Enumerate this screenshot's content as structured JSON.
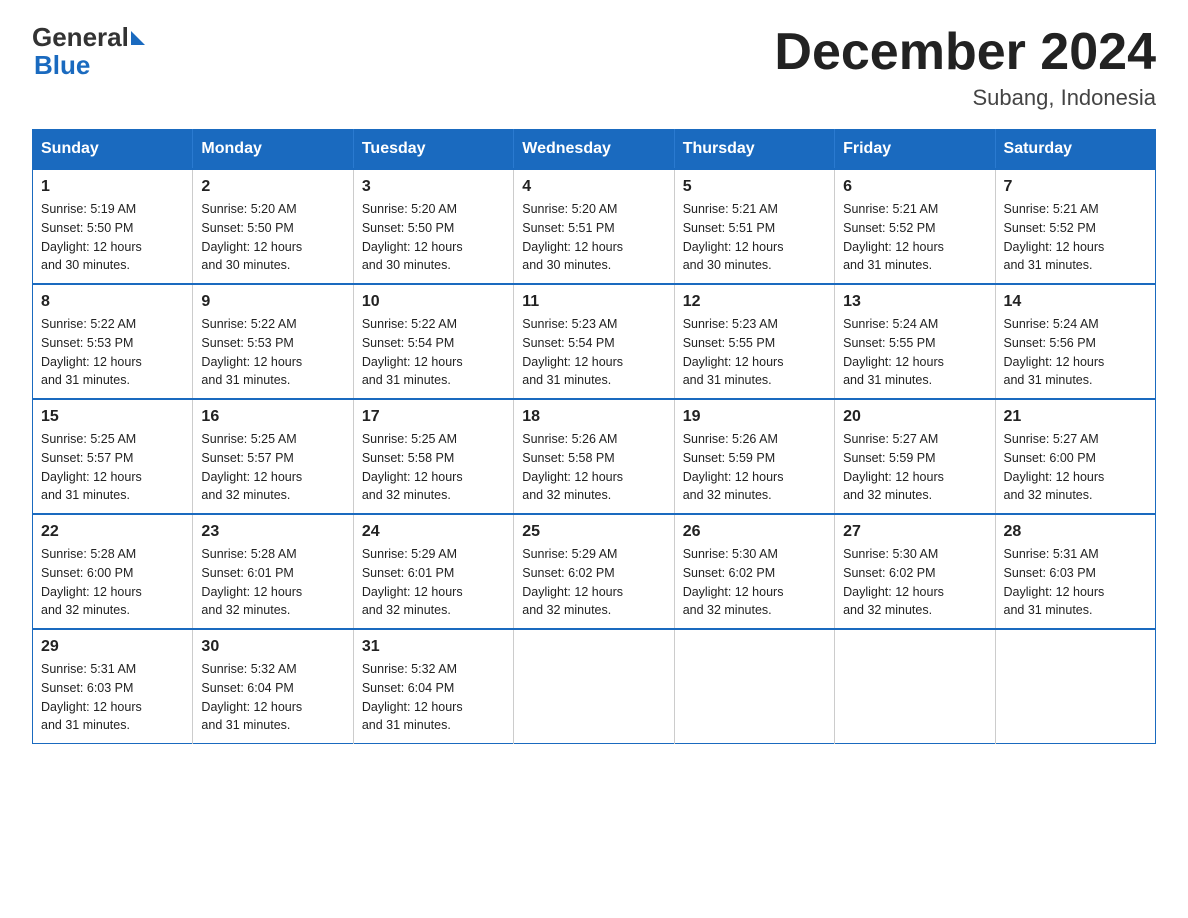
{
  "logo": {
    "general": "General",
    "blue": "Blue",
    "arrow": "▶"
  },
  "title": "December 2024",
  "subtitle": "Subang, Indonesia",
  "weekdays": [
    "Sunday",
    "Monday",
    "Tuesday",
    "Wednesday",
    "Thursday",
    "Friday",
    "Saturday"
  ],
  "weeks": [
    [
      {
        "day": "1",
        "sunrise": "5:19 AM",
        "sunset": "5:50 PM",
        "daylight": "12 hours and 30 minutes."
      },
      {
        "day": "2",
        "sunrise": "5:20 AM",
        "sunset": "5:50 PM",
        "daylight": "12 hours and 30 minutes."
      },
      {
        "day": "3",
        "sunrise": "5:20 AM",
        "sunset": "5:50 PM",
        "daylight": "12 hours and 30 minutes."
      },
      {
        "day": "4",
        "sunrise": "5:20 AM",
        "sunset": "5:51 PM",
        "daylight": "12 hours and 30 minutes."
      },
      {
        "day": "5",
        "sunrise": "5:21 AM",
        "sunset": "5:51 PM",
        "daylight": "12 hours and 30 minutes."
      },
      {
        "day": "6",
        "sunrise": "5:21 AM",
        "sunset": "5:52 PM",
        "daylight": "12 hours and 31 minutes."
      },
      {
        "day": "7",
        "sunrise": "5:21 AM",
        "sunset": "5:52 PM",
        "daylight": "12 hours and 31 minutes."
      }
    ],
    [
      {
        "day": "8",
        "sunrise": "5:22 AM",
        "sunset": "5:53 PM",
        "daylight": "12 hours and 31 minutes."
      },
      {
        "day": "9",
        "sunrise": "5:22 AM",
        "sunset": "5:53 PM",
        "daylight": "12 hours and 31 minutes."
      },
      {
        "day": "10",
        "sunrise": "5:22 AM",
        "sunset": "5:54 PM",
        "daylight": "12 hours and 31 minutes."
      },
      {
        "day": "11",
        "sunrise": "5:23 AM",
        "sunset": "5:54 PM",
        "daylight": "12 hours and 31 minutes."
      },
      {
        "day": "12",
        "sunrise": "5:23 AM",
        "sunset": "5:55 PM",
        "daylight": "12 hours and 31 minutes."
      },
      {
        "day": "13",
        "sunrise": "5:24 AM",
        "sunset": "5:55 PM",
        "daylight": "12 hours and 31 minutes."
      },
      {
        "day": "14",
        "sunrise": "5:24 AM",
        "sunset": "5:56 PM",
        "daylight": "12 hours and 31 minutes."
      }
    ],
    [
      {
        "day": "15",
        "sunrise": "5:25 AM",
        "sunset": "5:57 PM",
        "daylight": "12 hours and 31 minutes."
      },
      {
        "day": "16",
        "sunrise": "5:25 AM",
        "sunset": "5:57 PM",
        "daylight": "12 hours and 32 minutes."
      },
      {
        "day": "17",
        "sunrise": "5:25 AM",
        "sunset": "5:58 PM",
        "daylight": "12 hours and 32 minutes."
      },
      {
        "day": "18",
        "sunrise": "5:26 AM",
        "sunset": "5:58 PM",
        "daylight": "12 hours and 32 minutes."
      },
      {
        "day": "19",
        "sunrise": "5:26 AM",
        "sunset": "5:59 PM",
        "daylight": "12 hours and 32 minutes."
      },
      {
        "day": "20",
        "sunrise": "5:27 AM",
        "sunset": "5:59 PM",
        "daylight": "12 hours and 32 minutes."
      },
      {
        "day": "21",
        "sunrise": "5:27 AM",
        "sunset": "6:00 PM",
        "daylight": "12 hours and 32 minutes."
      }
    ],
    [
      {
        "day": "22",
        "sunrise": "5:28 AM",
        "sunset": "6:00 PM",
        "daylight": "12 hours and 32 minutes."
      },
      {
        "day": "23",
        "sunrise": "5:28 AM",
        "sunset": "6:01 PM",
        "daylight": "12 hours and 32 minutes."
      },
      {
        "day": "24",
        "sunrise": "5:29 AM",
        "sunset": "6:01 PM",
        "daylight": "12 hours and 32 minutes."
      },
      {
        "day": "25",
        "sunrise": "5:29 AM",
        "sunset": "6:02 PM",
        "daylight": "12 hours and 32 minutes."
      },
      {
        "day": "26",
        "sunrise": "5:30 AM",
        "sunset": "6:02 PM",
        "daylight": "12 hours and 32 minutes."
      },
      {
        "day": "27",
        "sunrise": "5:30 AM",
        "sunset": "6:02 PM",
        "daylight": "12 hours and 32 minutes."
      },
      {
        "day": "28",
        "sunrise": "5:31 AM",
        "sunset": "6:03 PM",
        "daylight": "12 hours and 31 minutes."
      }
    ],
    [
      {
        "day": "29",
        "sunrise": "5:31 AM",
        "sunset": "6:03 PM",
        "daylight": "12 hours and 31 minutes."
      },
      {
        "day": "30",
        "sunrise": "5:32 AM",
        "sunset": "6:04 PM",
        "daylight": "12 hours and 31 minutes."
      },
      {
        "day": "31",
        "sunrise": "5:32 AM",
        "sunset": "6:04 PM",
        "daylight": "12 hours and 31 minutes."
      },
      null,
      null,
      null,
      null
    ]
  ]
}
